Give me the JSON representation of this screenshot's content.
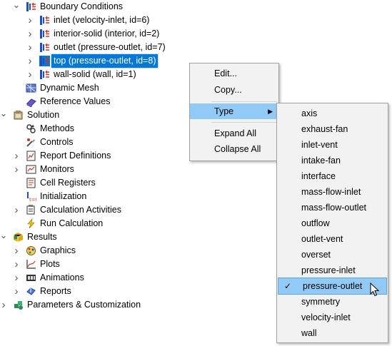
{
  "tree": [
    {
      "label": "Boundary Conditions",
      "indent": 1,
      "arrow": "down",
      "icon": "boundary-conditions-icon"
    },
    {
      "label": "inlet (velocity-inlet, id=6)",
      "indent": 2,
      "arrow": "right",
      "icon": "boundary-zone-icon"
    },
    {
      "label": "interior-solid (interior, id=2)",
      "indent": 2,
      "arrow": "right",
      "icon": "boundary-zone-icon"
    },
    {
      "label": "outlet (pressure-outlet, id=7)",
      "indent": 2,
      "arrow": "right",
      "icon": "boundary-zone-icon"
    },
    {
      "label": "top (pressure-outlet, id=8)",
      "indent": 2,
      "arrow": "right",
      "icon": "boundary-zone-icon",
      "selected": true
    },
    {
      "label": "wall-solid (wall, id=1)",
      "indent": 2,
      "arrow": "right",
      "icon": "boundary-zone-icon"
    },
    {
      "label": "Dynamic Mesh",
      "indent": 1,
      "arrow": "",
      "icon": "dynamic-mesh-icon"
    },
    {
      "label": "Reference Values",
      "indent": 1,
      "arrow": "",
      "icon": "reference-values-icon"
    },
    {
      "label": "Solution",
      "indent": 0,
      "arrow": "down",
      "icon": "solution-icon"
    },
    {
      "label": "Methods",
      "indent": 1,
      "arrow": "",
      "icon": "methods-icon"
    },
    {
      "label": "Controls",
      "indent": 1,
      "arrow": "",
      "icon": "controls-icon"
    },
    {
      "label": "Report Definitions",
      "indent": 1,
      "arrow": "right",
      "icon": "report-definitions-icon"
    },
    {
      "label": "Monitors",
      "indent": 1,
      "arrow": "right",
      "icon": "monitors-icon"
    },
    {
      "label": "Cell Registers",
      "indent": 1,
      "arrow": "",
      "icon": "cell-registers-icon"
    },
    {
      "label": "Initialization",
      "indent": 1,
      "arrow": "",
      "icon": "initialization-icon"
    },
    {
      "label": "Calculation Activities",
      "indent": 1,
      "arrow": "right",
      "icon": "calculation-activities-icon"
    },
    {
      "label": "Run Calculation",
      "indent": 1,
      "arrow": "",
      "icon": "run-calculation-icon"
    },
    {
      "label": "Results",
      "indent": 0,
      "arrow": "down",
      "icon": "results-icon"
    },
    {
      "label": "Graphics",
      "indent": 1,
      "arrow": "right",
      "icon": "graphics-icon"
    },
    {
      "label": "Plots",
      "indent": 1,
      "arrow": "right",
      "icon": "plots-icon"
    },
    {
      "label": "Animations",
      "indent": 1,
      "arrow": "right",
      "icon": "animations-icon"
    },
    {
      "label": "Reports",
      "indent": 1,
      "arrow": "right",
      "icon": "reports-icon"
    },
    {
      "label": "Parameters & Customization",
      "indent": 0,
      "arrow": "right",
      "icon": "parameters-icon"
    }
  ],
  "context_menu": {
    "edit": "Edit...",
    "copy": "Copy...",
    "type": "Type",
    "expand_all": "Expand All",
    "collapse_all": "Collapse All"
  },
  "type_submenu": {
    "items": [
      "axis",
      "exhaust-fan",
      "inlet-vent",
      "intake-fan",
      "interface",
      "mass-flow-inlet",
      "mass-flow-outlet",
      "outflow",
      "outlet-vent",
      "overset",
      "pressure-inlet",
      "pressure-outlet",
      "symmetry",
      "velocity-inlet",
      "wall"
    ],
    "checked": "pressure-outlet",
    "check_mark": "✓"
  },
  "colors": {
    "selection": "#0078d7",
    "menu_highlight": "#91c9f7",
    "menu_bg": "#f2f2f2"
  }
}
